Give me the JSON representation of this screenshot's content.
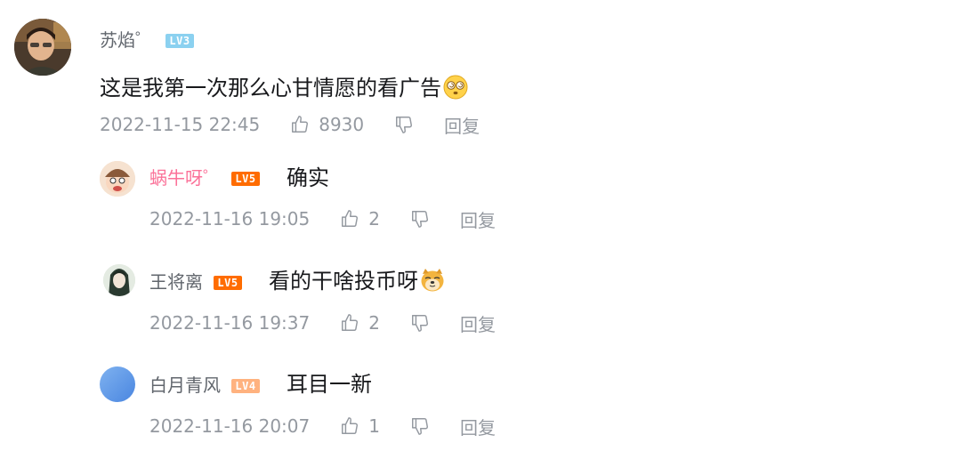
{
  "colors": {
    "name_default": "#61666d",
    "name_vip": "#fb7299",
    "meta": "#9499a0",
    "lv3": "#8bd1f0",
    "lv4": "#ffb27f",
    "lv5": "#ff6c00"
  },
  "main_comment": {
    "username": "苏焰゜",
    "level": "LV3",
    "text": "这是我第一次那么心甘情愿的看广告",
    "emoji": "dizzy-face-emoji",
    "time": "2022-11-15 22:45",
    "likes": "8930",
    "reply_label": "回复"
  },
  "replies": [
    {
      "username": "蜗牛呀゜",
      "level": "LV5",
      "text": "确实",
      "time": "2022-11-16 19:05",
      "likes": "2",
      "reply_label": "回复"
    },
    {
      "username": "王将离",
      "level": "LV5",
      "text": "看的干啥投币呀",
      "emoji": "doge-emoji",
      "time": "2022-11-16 19:37",
      "likes": "2",
      "reply_label": "回复"
    },
    {
      "username": "白月青风",
      "level": "LV4",
      "text": "耳目一新",
      "time": "2022-11-16 20:07",
      "likes": "1",
      "reply_label": "回复"
    }
  ]
}
